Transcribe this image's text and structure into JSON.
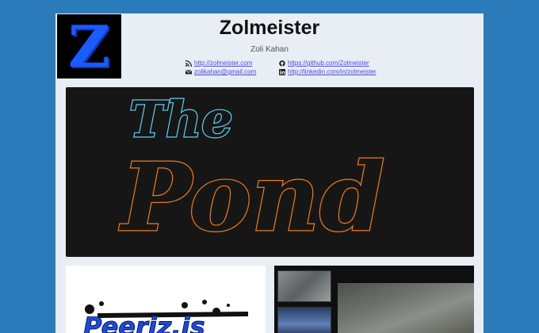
{
  "header": {
    "title": "Zolmeister",
    "subtitle": "Zoli Kahan",
    "logo_letter": "Z"
  },
  "links": [
    {
      "icon": "rss-icon",
      "text": "http://zolmeister.com"
    },
    {
      "icon": "github-icon",
      "text": "https://github.com/Zolmeister"
    },
    {
      "icon": "email-icon",
      "text": "zolikahan@gmail.com"
    },
    {
      "icon": "linkedin-icon",
      "text": "http://linkedin.com/in/zolmeister"
    }
  ],
  "banner": {
    "line1": "The",
    "line2": "Pond"
  },
  "project2": {
    "logo_text": "Peeriz.is"
  },
  "colors": {
    "background": "#2b7bba",
    "page": "#e8eef3",
    "link": "#4a4ae8",
    "pond_the": "#5bd0f0",
    "pond_pond": "#f07a1a"
  }
}
